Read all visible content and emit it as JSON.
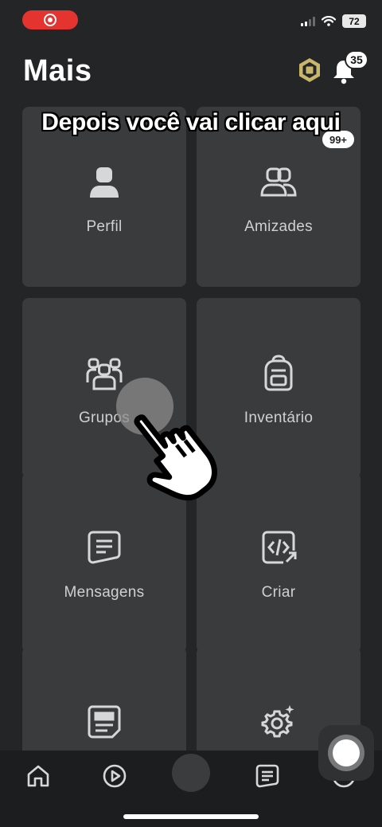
{
  "status_bar": {
    "battery": "72",
    "icons": [
      "signal-icon",
      "wifi-icon",
      "battery-icon",
      "screen-record-icon"
    ]
  },
  "header": {
    "title": "Mais",
    "notification_count": "35",
    "icons": [
      "robux-icon",
      "bell-icon"
    ]
  },
  "caption": "Depois você vai clicar aqui",
  "tiles": [
    {
      "label": "Perfil",
      "icon": "profile-icon"
    },
    {
      "label": "Amizades",
      "icon": "friends-icon",
      "badge": "99+"
    },
    {
      "label": "Grupos",
      "icon": "groups-icon"
    },
    {
      "label": "Inventário",
      "icon": "backpack-icon"
    },
    {
      "label": "Mensagens",
      "icon": "messages-icon"
    },
    {
      "label": "Criar",
      "icon": "create-code-icon"
    },
    {
      "label": "",
      "icon": "blog-icon"
    },
    {
      "label": "",
      "icon": "settings-icon"
    }
  ],
  "bottom_nav": {
    "items": [
      "home-icon",
      "play-icon",
      "avatar-icon",
      "chat-icon",
      "more-icon"
    ]
  },
  "colors": {
    "background": "#232527",
    "tile": "#393b3d",
    "record": "#e5342f",
    "robux": "#c9b66a"
  }
}
